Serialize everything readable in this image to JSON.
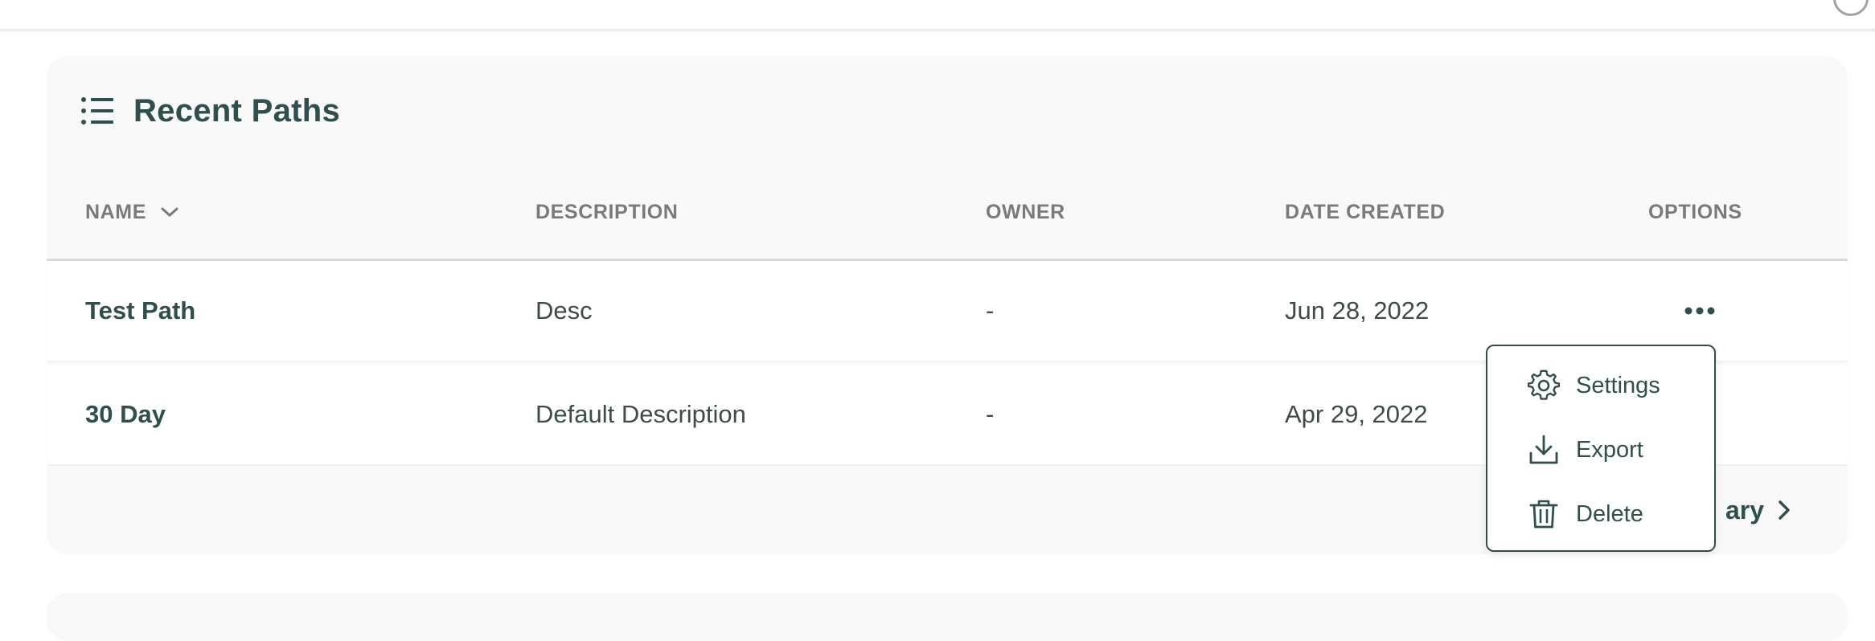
{
  "card": {
    "title": "Recent Paths"
  },
  "table": {
    "columns": {
      "name": "NAME",
      "description": "DESCRIPTION",
      "owner": "OWNER",
      "date_created": "DATE CREATED",
      "options": "OPTIONS"
    },
    "rows": [
      {
        "name": "Test Path",
        "description": "Desc",
        "owner": "-",
        "date_created": "Jun 28, 2022"
      },
      {
        "name": "30 Day",
        "description": "Default Description",
        "owner": "-",
        "date_created": "Apr 29, 2022"
      }
    ]
  },
  "footer": {
    "link_visible_text": "ary"
  },
  "options_menu": {
    "items": [
      {
        "label": "Settings",
        "icon": "gear-icon"
      },
      {
        "label": "Export",
        "icon": "download-icon"
      },
      {
        "label": "Delete",
        "icon": "trash-icon"
      }
    ]
  },
  "colors": {
    "primary": "#2f4f4f",
    "header_text": "#7a7a7a",
    "card_bg": "#f8f8f8"
  }
}
